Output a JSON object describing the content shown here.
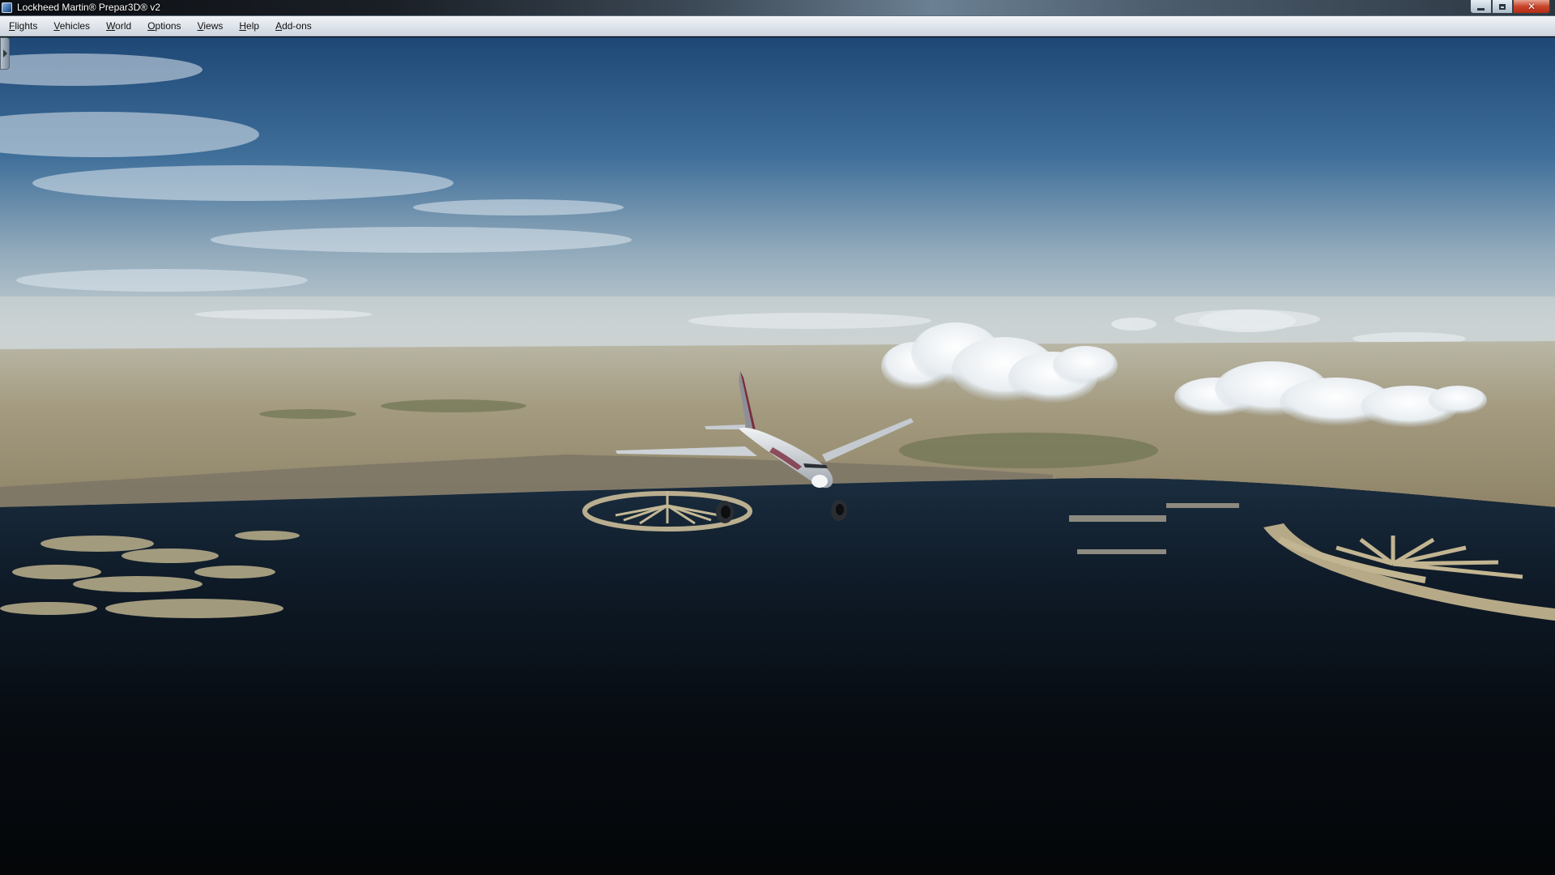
{
  "window": {
    "title": "Lockheed Martin® Prepar3D® v2",
    "overlay_text": "",
    "controls": [
      "minimize-icon",
      "maximize-icon",
      "close-icon"
    ]
  },
  "menu": {
    "items": [
      {
        "label": "Flights"
      },
      {
        "label": "Vehicles"
      },
      {
        "label": "World"
      },
      {
        "label": "Options"
      },
      {
        "label": "Views"
      },
      {
        "label": "Help"
      },
      {
        "label": "Add-ons"
      }
    ]
  },
  "scene": {
    "description_icons": [
      "airliner-icon",
      "palm-island-icon",
      "world-islands-icon"
    ],
    "colors": {
      "sky_top": "#1f4a7a",
      "sky_horizon": "#c9d2d6",
      "land": "#9d9174",
      "sea_near": "#070b10",
      "sea_far": "#17283a"
    }
  }
}
